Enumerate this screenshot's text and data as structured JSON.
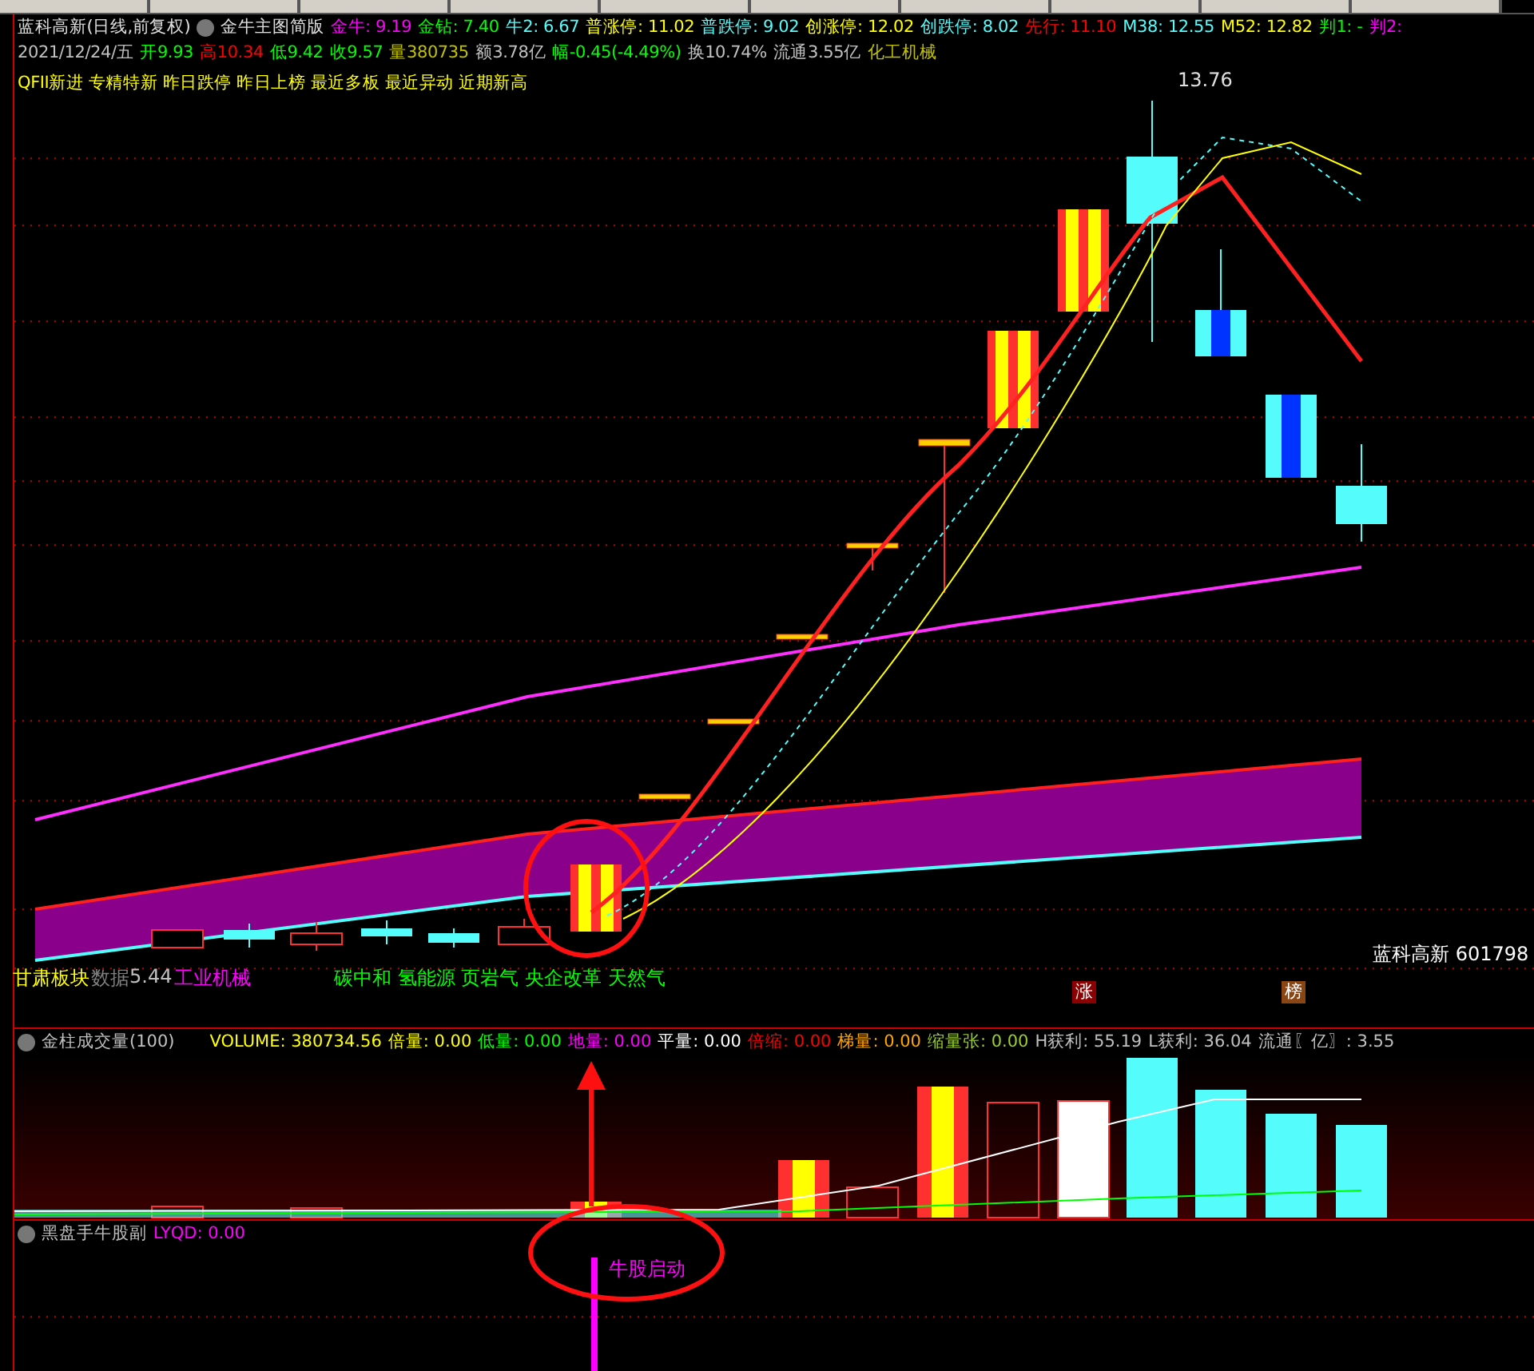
{
  "header": {
    "title": "蓝科高新(日线,前复权)",
    "indicator_name": "金牛主图简版",
    "values": [
      {
        "label": "金牛:",
        "value": "9.19",
        "color": "#ff00ff"
      },
      {
        "label": "金钻:",
        "value": "7.40",
        "color": "#00ff00"
      },
      {
        "label": "牛2:",
        "value": "6.67",
        "color": "#54fcfc"
      },
      {
        "label": "普涨停:",
        "value": "11.02",
        "color": "#ffff00"
      },
      {
        "label": "普跌停:",
        "value": "9.02",
        "color": "#54fcfc"
      },
      {
        "label": "创涨停:",
        "value": "12.02",
        "color": "#ffff00"
      },
      {
        "label": "创跌停:",
        "value": "8.02",
        "color": "#54fcfc"
      },
      {
        "label": "先行:",
        "value": "11.10",
        "color": "#ff0000"
      },
      {
        "label": "M38:",
        "value": "12.55",
        "color": "#54fcfc"
      },
      {
        "label": "M52:",
        "value": "12.82",
        "color": "#ffff00"
      },
      {
        "label": "判1:",
        "value": "-",
        "color": "#00ff00"
      },
      {
        "label": "判2:",
        "color": "#ff00ff"
      }
    ]
  },
  "quote": [
    {
      "text": "2021/12/24/五",
      "color": "#c0c0c0"
    },
    {
      "text": "开9.93",
      "color": "#00ff00"
    },
    {
      "text": "高10.34",
      "color": "#ff0000"
    },
    {
      "text": "低9.42",
      "color": "#00ff00"
    },
    {
      "text": "收9.57",
      "color": "#00ff00"
    },
    {
      "text": "量380735",
      "color": "#c0c000"
    },
    {
      "text": "额3.78亿",
      "color": "#c0c0c0"
    },
    {
      "text": "幅-0.45(-4.49%)",
      "color": "#00ff00"
    },
    {
      "text": "换10.74%",
      "color": "#c0c0c0"
    },
    {
      "text": "流通3.55亿",
      "color": "#c0c0c0"
    },
    {
      "text": "化工机械",
      "color": "#c0c000"
    }
  ],
  "tags_line": "QFII新进 专精特新 昨日跌停 昨日上榜 最近多板 最近异动 近期新高",
  "main_chart": {
    "high_label": "13.76",
    "stock_label": "蓝科高新 601798",
    "concepts": [
      {
        "text": "甘肃板块",
        "color": "#ffff00"
      },
      {
        "text": "数据",
        "color": "#808080"
      },
      {
        "text": "5.44",
        "color": "#c0c0c0"
      },
      {
        "text": "工业机械",
        "color": "#ff00ff"
      },
      {
        "text": "碳中和 氢能源 页岩气 央企改革 天然气",
        "color": "#00ff00"
      }
    ],
    "badges": [
      {
        "text": "涨",
        "color": "#8b0000"
      },
      {
        "text": "榜",
        "color": "#8b4513"
      }
    ]
  },
  "volume_panel": {
    "title": "金柱成交量(100)",
    "values": [
      {
        "label": "VOLUME:",
        "value": "380734.56",
        "color": "#ffff00"
      },
      {
        "label": "倍量:",
        "value": "0.00",
        "color": "#ffff00"
      },
      {
        "label": "低量:",
        "value": "0.00",
        "color": "#00ff00"
      },
      {
        "label": "地量:",
        "value": "0.00",
        "color": "#ff00ff"
      },
      {
        "label": "平量:",
        "value": "0.00",
        "color": "#ffffff"
      },
      {
        "label": "倍缩:",
        "value": "0.00",
        "color": "#ff0000"
      },
      {
        "label": "梯量:",
        "value": "0.00",
        "color": "#ffa500"
      },
      {
        "label": "缩量张:",
        "value": "0.00",
        "color": "#9acd32"
      },
      {
        "label": "H获利:",
        "value": "55.19",
        "color": "#c0c0c0"
      },
      {
        "label": "L获利:",
        "value": "36.04",
        "color": "#c0c0c0"
      },
      {
        "label": "流通〖亿〗:",
        "value": "3.55",
        "color": "#c0c0c0"
      }
    ]
  },
  "indicator_panel": {
    "title": "黑盘手牛股副",
    "values": [
      {
        "label": "LYQD:",
        "value": "0.00",
        "color": "#ff00ff"
      }
    ],
    "annotation": "牛股启动"
  }
}
